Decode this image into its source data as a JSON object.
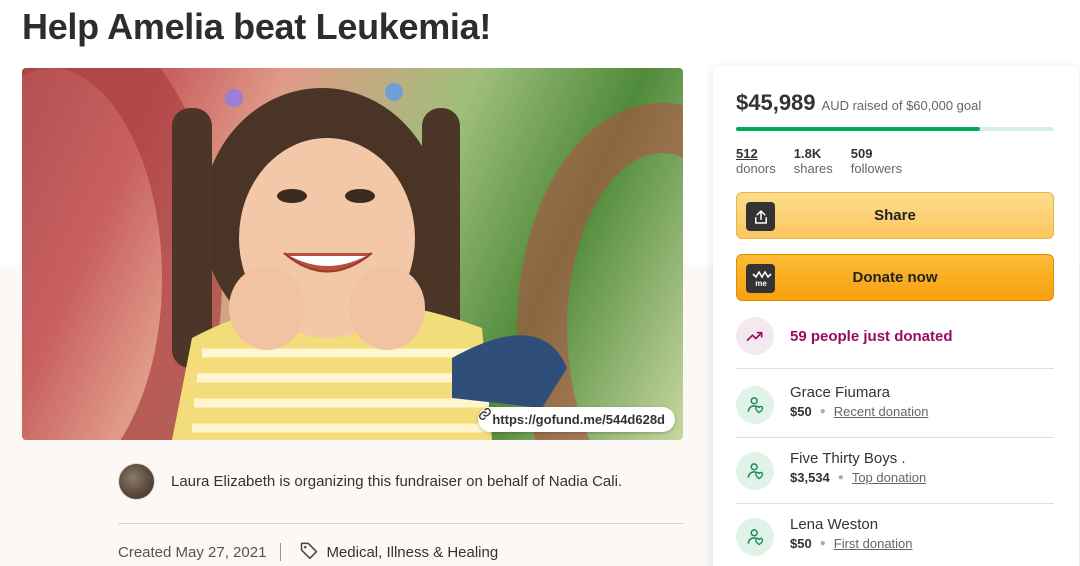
{
  "page": {
    "title": "Help Amelia beat Leukemia!"
  },
  "hero": {
    "link": "https://gofund.me/544d628d"
  },
  "organizer": {
    "text": "Laura Elizabeth is organizing this fundraiser on behalf of Nadia Cali."
  },
  "meta": {
    "created": "Created May 27, 2021",
    "category": "Medical, Illness & Healing"
  },
  "panel": {
    "raised_amount": "$45,989",
    "raised_text": "AUD raised of $60,000 goal",
    "progress_fraction": 0.766,
    "stats": [
      {
        "num": "512",
        "label": "donors"
      },
      {
        "num": "1.8K",
        "label": "shares"
      },
      {
        "num": "509",
        "label": "followers"
      }
    ],
    "share_label": "Share",
    "donate_label": "Donate now",
    "trend_text": "59 people just donated",
    "donors": [
      {
        "name": "Grace Fiumara",
        "amount": "$50",
        "kind": "Recent donation"
      },
      {
        "name": "Five Thirty Boys .",
        "amount": "$3,534",
        "kind": "Top donation"
      },
      {
        "name": "Lena Weston",
        "amount": "$50",
        "kind": "First donation"
      }
    ]
  },
  "colors": {
    "progress": "#02a95c",
    "trend": "#9a0b62",
    "donate": "#f7a10d",
    "share": "#fbc75f"
  },
  "icons": [
    "link-icon",
    "tag-icon",
    "share-upload-icon",
    "gofundme-logo-icon",
    "trending-icon",
    "donor-heart-icon"
  ]
}
